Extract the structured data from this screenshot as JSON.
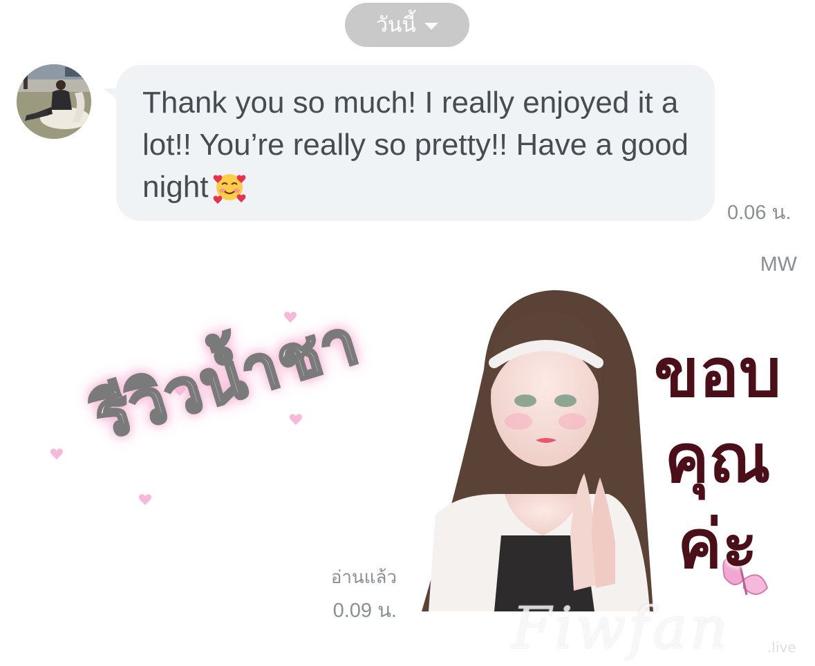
{
  "date_pill": {
    "label": "วันนี้"
  },
  "incoming": {
    "message": "Thank you so much! I really enjoyed it a lot!! You’re really so pretty!! Have a good night",
    "emoji": "smiling-face-with-hearts",
    "time": "0.06 น."
  },
  "outgoing": {
    "sender": "MW",
    "read_status": "อ่านแล้ว",
    "time": "0.09 น.",
    "sticker_1": {
      "text": "รีวิวน้ำชา"
    },
    "sticker_2": {
      "text_lines": [
        "ขอบ",
        "คุณ",
        "ค่ะ"
      ]
    }
  },
  "watermark": {
    "text": "Fiwfan",
    "sub": ".live"
  },
  "colors": {
    "bubble_bg": "#eff3f5",
    "muted_text": "#8a8f94",
    "pill_bg": "#c9c9c9",
    "sticker_pink": "#f5b7d6",
    "sticker_dark": "#4a0f18"
  }
}
